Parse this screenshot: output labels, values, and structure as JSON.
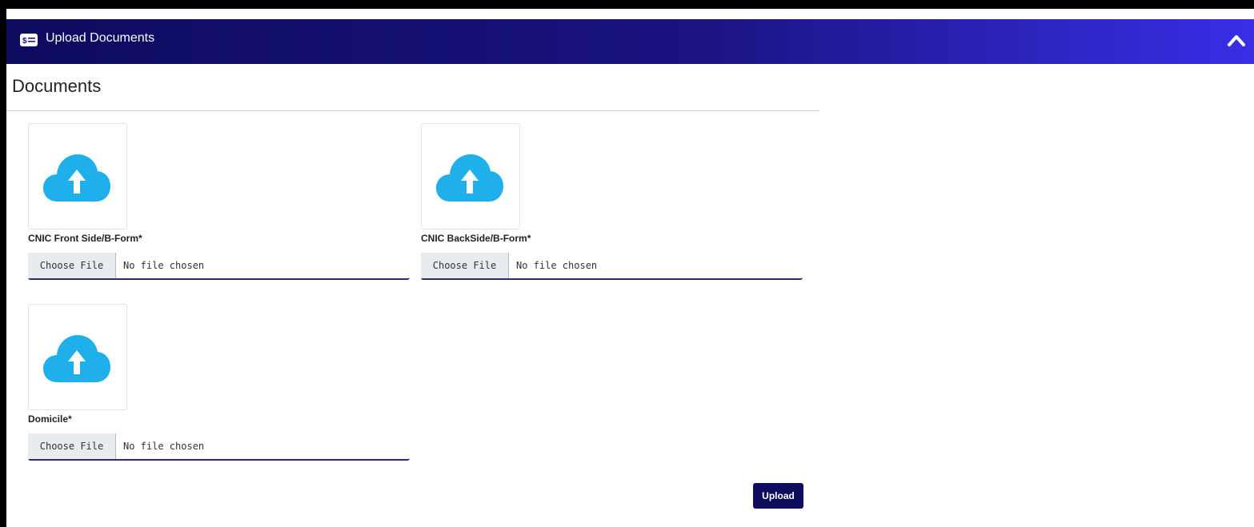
{
  "panel": {
    "title": "Upload Documents",
    "header_icon": "money-list-icon",
    "collapse_icon": "chevron-up-icon",
    "colors": {
      "header_start": "#0d0b5e",
      "header_end": "#3a2ee6",
      "cloud": "#1fb0ec",
      "button": "#0e0c5c"
    }
  },
  "section": {
    "title": "Documents"
  },
  "documents": [
    {
      "label": "CNIC Front Side/B-Form*",
      "choose_label": "Choose File",
      "status": "No file chosen",
      "icon": "cloud-upload-icon"
    },
    {
      "label": "CNIC BackSide/B-Form*",
      "choose_label": "Choose File",
      "status": "No file chosen",
      "icon": "cloud-upload-icon"
    },
    {
      "label": "Domicile*",
      "choose_label": "Choose File",
      "status": "No file chosen",
      "icon": "cloud-upload-icon"
    }
  ],
  "actions": {
    "upload_label": "Upload"
  }
}
